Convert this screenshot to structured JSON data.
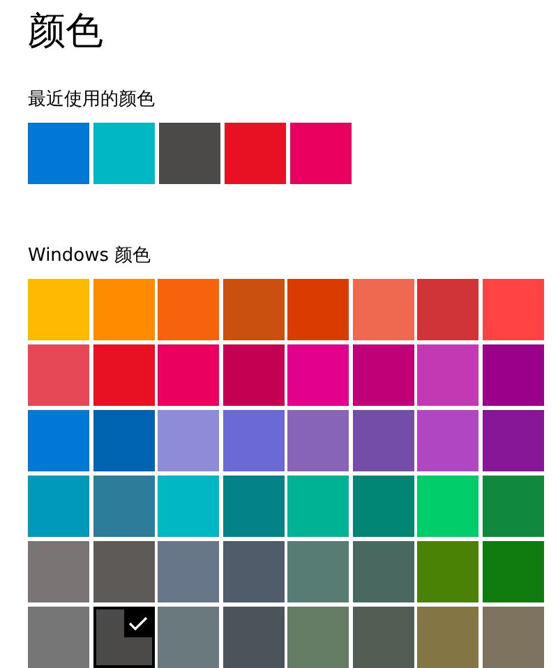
{
  "title": "颜色",
  "recent": {
    "label": "最近使用的颜色",
    "swatches": [
      {
        "color": "#0078d7",
        "selected": false
      },
      {
        "color": "#00b7c3",
        "selected": false
      },
      {
        "color": "#4c4a48",
        "selected": false
      },
      {
        "color": "#e81123",
        "selected": false
      },
      {
        "color": "#ea005e",
        "selected": false
      }
    ]
  },
  "windows_colors": {
    "label": "Windows 颜色",
    "swatches": [
      {
        "color": "#ffb900",
        "selected": false
      },
      {
        "color": "#ff8c00",
        "selected": false
      },
      {
        "color": "#f7630c",
        "selected": false
      },
      {
        "color": "#ca5010",
        "selected": false
      },
      {
        "color": "#da3b01",
        "selected": false
      },
      {
        "color": "#ef6950",
        "selected": false
      },
      {
        "color": "#d13438",
        "selected": false
      },
      {
        "color": "#ff4343",
        "selected": false
      },
      {
        "color": "#e74856",
        "selected": false
      },
      {
        "color": "#e81123",
        "selected": false
      },
      {
        "color": "#ea005e",
        "selected": false
      },
      {
        "color": "#c30052",
        "selected": false
      },
      {
        "color": "#e3008c",
        "selected": false
      },
      {
        "color": "#bf0077",
        "selected": false
      },
      {
        "color": "#c239b3",
        "selected": false
      },
      {
        "color": "#9a0089",
        "selected": false
      },
      {
        "color": "#0078d7",
        "selected": false
      },
      {
        "color": "#0063b1",
        "selected": false
      },
      {
        "color": "#8e8cd8",
        "selected": false
      },
      {
        "color": "#6b69d6",
        "selected": false
      },
      {
        "color": "#8764b8",
        "selected": false
      },
      {
        "color": "#744da9",
        "selected": false
      },
      {
        "color": "#b146c2",
        "selected": false
      },
      {
        "color": "#881798",
        "selected": false
      },
      {
        "color": "#0099bc",
        "selected": false
      },
      {
        "color": "#2d7d9a",
        "selected": false
      },
      {
        "color": "#00b7c3",
        "selected": false
      },
      {
        "color": "#038387",
        "selected": false
      },
      {
        "color": "#00b294",
        "selected": false
      },
      {
        "color": "#018574",
        "selected": false
      },
      {
        "color": "#00cc6a",
        "selected": false
      },
      {
        "color": "#10893e",
        "selected": false
      },
      {
        "color": "#7a7574",
        "selected": false
      },
      {
        "color": "#5d5a58",
        "selected": false
      },
      {
        "color": "#68768a",
        "selected": false
      },
      {
        "color": "#515c6b",
        "selected": false
      },
      {
        "color": "#567c73",
        "selected": false
      },
      {
        "color": "#486860",
        "selected": false
      },
      {
        "color": "#498205",
        "selected": false
      },
      {
        "color": "#107c10",
        "selected": false
      },
      {
        "color": "#767676",
        "selected": false
      },
      {
        "color": "#4c4a48",
        "selected": true
      },
      {
        "color": "#69797e",
        "selected": false
      },
      {
        "color": "#4a5459",
        "selected": false
      },
      {
        "color": "#647c64",
        "selected": false
      },
      {
        "color": "#525e54",
        "selected": false
      },
      {
        "color": "#847545",
        "selected": false
      },
      {
        "color": "#7e735f",
        "selected": false
      }
    ]
  }
}
